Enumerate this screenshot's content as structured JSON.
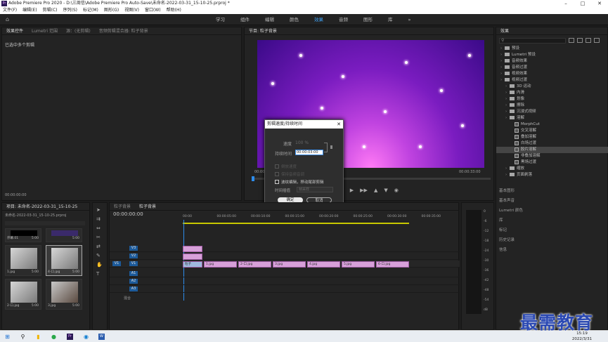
{
  "title_bar": {
    "app_icon": "Pr",
    "title": "Adobe Premiere Pro 2020 - D:\\三周信\\Adobe Premiere Pro Auto-Save\\未命名-2022-03-31_15-10-25.prproj *"
  },
  "menu": [
    "文件(F)",
    "编辑(E)",
    "剪辑(C)",
    "序列(S)",
    "标记(M)",
    "图形(G)",
    "视图(V)",
    "窗口(W)",
    "帮助(H)"
  ],
  "workspaces": {
    "items": [
      "学习",
      "组件",
      "编辑",
      "颜色",
      "效果",
      "音频",
      "图形",
      "库"
    ],
    "active": "效果",
    "more": "»"
  },
  "effect_controls": {
    "tabs": [
      "效果控件",
      "Lumetri 范围",
      "源：(无剪辑)",
      "音频剪辑混合器: 粒子背景"
    ],
    "message": "已选中多个剪辑",
    "timecode": "00:00:00:00"
  },
  "program_monitor": {
    "tab": "节目: 粒子背景",
    "timecode_left": "00:00",
    "timecode_right": "00:00:33:00"
  },
  "dialog": {
    "title": "剪辑速度/持续时间",
    "speed_label": "速度",
    "speed_value": "100 %",
    "duration_label": "持续时间",
    "duration_value": "00:00:03:00",
    "reverse_label": "倒放速度",
    "keep_pitch_label": "保持音频音调",
    "ripple_label": "波纹编辑，移动尾部剪辑",
    "interp_label": "时间插值",
    "interp_value": "帧采样",
    "ok": "确定",
    "cancel": "取消"
  },
  "project": {
    "tab": "项目: 未命名-2022-03-31_15-10-25",
    "file": "未命名-2022-03-31_15-10-25.prproj",
    "items": [
      {
        "name": "序幕.01",
        "dur": "5:00"
      },
      {
        "name": "",
        "dur": "5:00"
      },
      {
        "name": "1.jpg",
        "dur": "5:00"
      },
      {
        "name": "4-口.jpg",
        "dur": "5:00"
      },
      {
        "name": "2-口.jpg",
        "dur": "5:00"
      },
      {
        "name": "3.jpg",
        "dur": "5:00"
      }
    ]
  },
  "timeline": {
    "tabs": [
      "粒子背景",
      "粒子背景"
    ],
    "timecode": "00:00:00:00",
    "ruler": [
      "00:00",
      "00:00:05:00",
      "00:00:10:00",
      "00:00:15:00",
      "00:00:20:00",
      "00:00:25:00",
      "00:00:30:00",
      "00:00:35:00"
    ],
    "video_tracks": [
      "V3",
      "V2",
      "V1"
    ],
    "audio_tracks": [
      "A1",
      "A2",
      "A3"
    ],
    "source_v": "V1",
    "mix_label": "混合",
    "particle_clip": "粒子",
    "clips": [
      "1.jpg",
      "2-口.jpg",
      "3.jpg",
      "4.jpg",
      "5.jpg",
      "6-口.jpg"
    ]
  },
  "meter": {
    "scale": [
      "0",
      "-6",
      "-12",
      "-18",
      "-24",
      "-30",
      "-36",
      "-42",
      "-48",
      "-54",
      "dB"
    ]
  },
  "effects": {
    "tab": "效果",
    "tree": [
      {
        "label": "预设",
        "level": 0,
        "type": "folder"
      },
      {
        "label": "Lumetri 预设",
        "level": 0,
        "type": "folder"
      },
      {
        "label": "音频效果",
        "level": 0,
        "type": "folder"
      },
      {
        "label": "音频过渡",
        "level": 0,
        "type": "folder"
      },
      {
        "label": "视频效果",
        "level": 0,
        "type": "folder"
      },
      {
        "label": "视频过渡",
        "level": 0,
        "type": "folder"
      },
      {
        "label": "3D 运动",
        "level": 1,
        "type": "folder"
      },
      {
        "label": "内滑",
        "level": 1,
        "type": "folder"
      },
      {
        "label": "划像",
        "level": 1,
        "type": "folder"
      },
      {
        "label": "擦除",
        "level": 1,
        "type": "folder"
      },
      {
        "label": "沉浸式视频",
        "level": 1,
        "type": "folder"
      },
      {
        "label": "溶解",
        "level": 1,
        "type": "folder"
      },
      {
        "label": "MorphCut",
        "level": 2,
        "type": "fx"
      },
      {
        "label": "交叉溶解",
        "level": 2,
        "type": "fx"
      },
      {
        "label": "叠加溶解",
        "level": 2,
        "type": "fx"
      },
      {
        "label": "白场过渡",
        "level": 2,
        "type": "fx"
      },
      {
        "label": "胶片溶解",
        "level": 2,
        "type": "fx",
        "selected": true
      },
      {
        "label": "非叠加溶解",
        "level": 2,
        "type": "fx"
      },
      {
        "label": "黑场过渡",
        "level": 2,
        "type": "fx"
      },
      {
        "label": "缩放",
        "level": 1,
        "type": "folder"
      },
      {
        "label": "页面剥落",
        "level": 1,
        "type": "folder"
      }
    ],
    "panels": [
      "基本图形",
      "基本声音",
      "Lumetri 颜色",
      "库",
      "标记",
      "历史记录",
      "信息"
    ]
  },
  "taskbar": {
    "time": "15:19",
    "date": "2022/3/31"
  },
  "watermark": "最需教育"
}
